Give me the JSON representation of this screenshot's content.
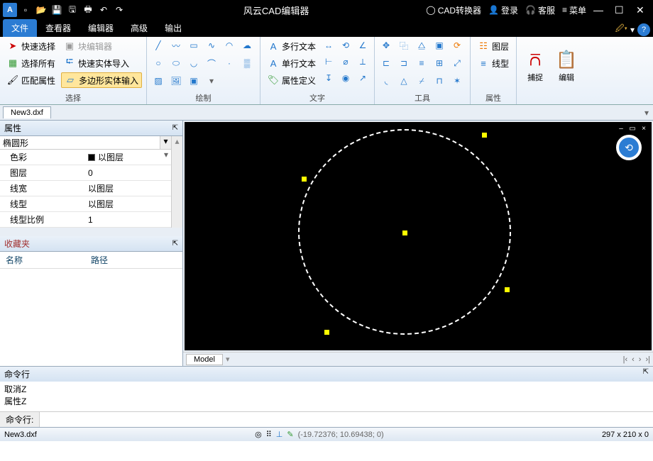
{
  "titlebar": {
    "app_title": "风云CAD编辑器"
  },
  "titlebar_right": {
    "converter": "CAD转换器",
    "login": "登录",
    "service": "客服",
    "menu": "菜单"
  },
  "tabs": {
    "file": "文件",
    "viewer": "查看器",
    "editor": "编辑器",
    "advanced": "高级",
    "output": "输出"
  },
  "ribbon": {
    "select": {
      "quick": "快速选择",
      "all": "选择所有",
      "match": "匹配属性",
      "block_edit": "块编辑器",
      "import": "快速实体导入",
      "polygon": "多边形实体输入",
      "label": "选择"
    },
    "draw": {
      "label": "绘制"
    },
    "text": {
      "mtext": "多行文本",
      "stext": "单行文本",
      "attdef": "属性定义",
      "label": "文字"
    },
    "tools": {
      "label": "工具"
    },
    "props": {
      "layer": "图层",
      "linetype": "线型",
      "label": "属性"
    },
    "snap": "捕捉",
    "edit": "编辑"
  },
  "doc": {
    "name": "New3.dxf"
  },
  "panel": {
    "properties": "属性",
    "entity_type": "椭圆形",
    "rows": {
      "color_k": "色彩",
      "color_v": "以图层",
      "layer_k": "图层",
      "layer_v": "0",
      "lw_k": "线宽",
      "lw_v": "以图层",
      "lt_k": "线型",
      "lt_v": "以图层",
      "lts_k": "线型比例",
      "lts_v": "1"
    },
    "favorites": "收藏夹",
    "fav_name": "名称",
    "fav_path": "路径"
  },
  "model": {
    "tab": "Model"
  },
  "cmd": {
    "title": "命令行",
    "log1": "取消Z",
    "log2": "属性Z",
    "prompt": "命令行:"
  },
  "status": {
    "file": "New3.dxf",
    "coords": "(-19.72376; 10.69438; 0)",
    "dims": "297 x 210 x 0"
  }
}
